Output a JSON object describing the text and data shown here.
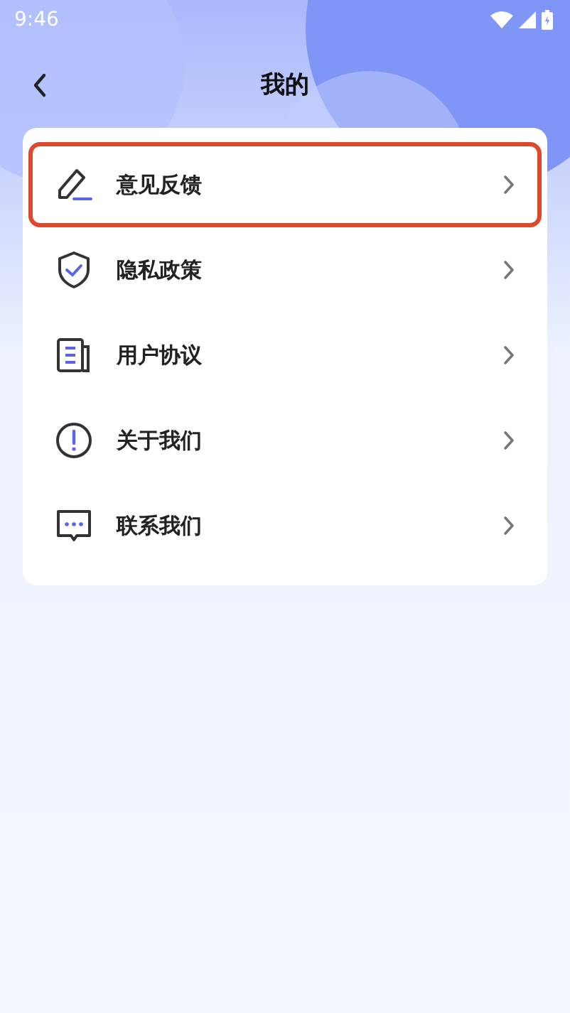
{
  "status_bar": {
    "time": "9:46"
  },
  "header": {
    "title": "我的"
  },
  "menu": [
    {
      "label": "意见反馈",
      "selected": true
    },
    {
      "label": "隐私政策",
      "selected": false
    },
    {
      "label": "用户协议",
      "selected": false
    },
    {
      "label": "关于我们",
      "selected": false
    },
    {
      "label": "联系我们",
      "selected": false
    }
  ]
}
